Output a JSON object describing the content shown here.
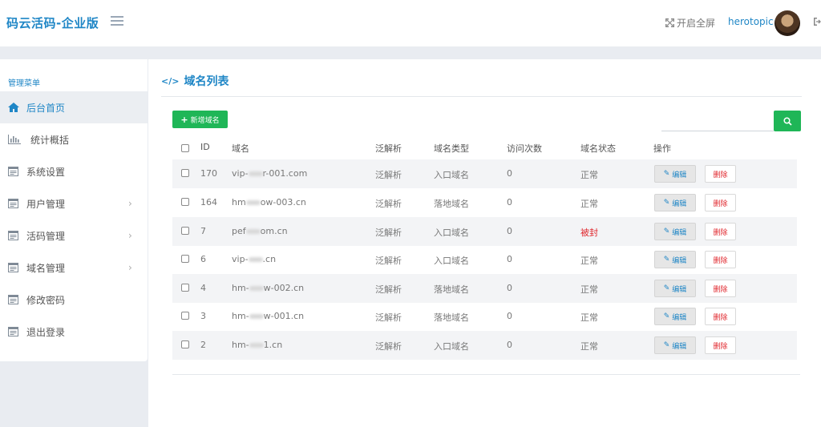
{
  "header": {
    "logo": "码云活码-企业版",
    "fullscreen_label": "开启全屏",
    "username": "herotopic"
  },
  "sidebar": {
    "title": "管理菜单",
    "items": [
      {
        "label": "后台首页",
        "icon": "home-icon",
        "active": true,
        "chevron": false
      },
      {
        "label": "统计概括",
        "icon": "bar-chart-icon",
        "active": false,
        "chevron": false
      },
      {
        "label": "系统设置",
        "icon": "list-icon",
        "active": false,
        "chevron": false
      },
      {
        "label": "用户管理",
        "icon": "list-icon",
        "active": false,
        "chevron": true
      },
      {
        "label": "活码管理",
        "icon": "list-icon",
        "active": false,
        "chevron": true
      },
      {
        "label": "域名管理",
        "icon": "list-icon",
        "active": false,
        "chevron": true
      },
      {
        "label": "修改密码",
        "icon": "list-icon",
        "active": false,
        "chevron": false
      },
      {
        "label": "退出登录",
        "icon": "list-icon",
        "active": false,
        "chevron": false
      }
    ]
  },
  "main": {
    "title": "域名列表",
    "add_button": "新增域名",
    "search": {
      "value": "",
      "placeholder": ""
    },
    "columns": [
      "ID",
      "域名",
      "泛解析",
      "域名类型",
      "访问次数",
      "域名状态",
      "操作"
    ],
    "edit_label": "编辑",
    "delete_label": "删除",
    "rows": [
      {
        "id": "170",
        "domain_pre": "vip-",
        "domain_post": "r-001.com",
        "wildcard": "泛解析",
        "type": "入口域名",
        "visits": "0",
        "status": "正常",
        "banned": false
      },
      {
        "id": "164",
        "domain_pre": "hm",
        "domain_post": "ow-003.cn",
        "wildcard": "泛解析",
        "type": "落地域名",
        "visits": "0",
        "status": "正常",
        "banned": false
      },
      {
        "id": "7",
        "domain_pre": "pef",
        "domain_post": "om.cn",
        "wildcard": "泛解析",
        "type": "入口域名",
        "visits": "0",
        "status": "被封",
        "banned": true
      },
      {
        "id": "6",
        "domain_pre": "vip-",
        "domain_post": ".cn",
        "wildcard": "泛解析",
        "type": "入口域名",
        "visits": "0",
        "status": "正常",
        "banned": false
      },
      {
        "id": "4",
        "domain_pre": "hm-",
        "domain_post": "w-002.cn",
        "wildcard": "泛解析",
        "type": "落地域名",
        "visits": "0",
        "status": "正常",
        "banned": false
      },
      {
        "id": "3",
        "domain_pre": "hm-",
        "domain_post": "w-001.cn",
        "wildcard": "泛解析",
        "type": "落地域名",
        "visits": "0",
        "status": "正常",
        "banned": false
      },
      {
        "id": "2",
        "domain_pre": "hm-",
        "domain_post": "1.cn",
        "wildcard": "泛解析",
        "type": "入口域名",
        "visits": "0",
        "status": "正常",
        "banned": false
      }
    ]
  },
  "colors": {
    "accent": "#1f86c6",
    "success": "#1fb657",
    "danger": "#e0262c"
  }
}
